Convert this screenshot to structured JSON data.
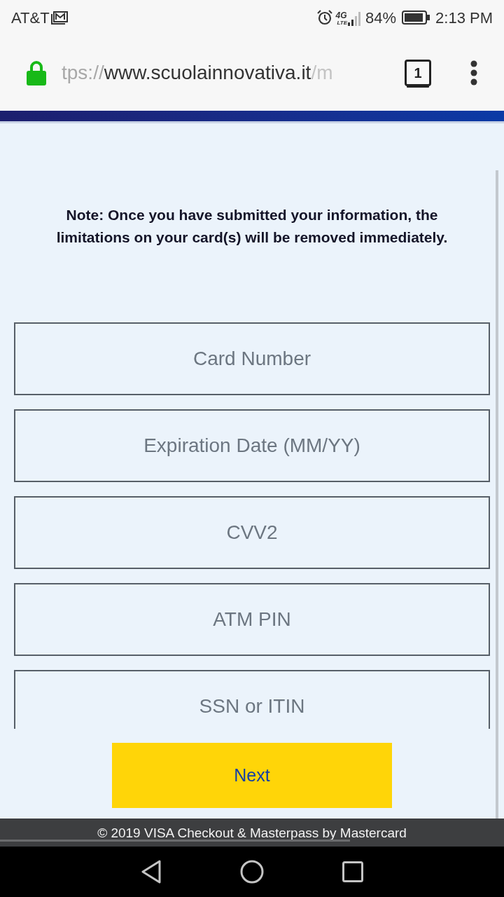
{
  "status_bar": {
    "carrier": "AT&T",
    "network": "4G",
    "network_sub": "LTE",
    "battery": "84%",
    "time": "2:13 PM"
  },
  "browser": {
    "url": {
      "scheme": "tps://",
      "host": "www.scuolainnovativa.it",
      "path": "/m"
    },
    "tab_count": "1"
  },
  "note": "Note: Once you have submitted your information, the limitations on your card(s) will be removed immediately.",
  "fields": [
    {
      "placeholder": "Card Number"
    },
    {
      "placeholder": "Expiration Date (MM/YY)"
    },
    {
      "placeholder": "CVV2"
    },
    {
      "placeholder": "ATM PIN"
    },
    {
      "placeholder": "SSN or ITIN"
    }
  ],
  "next_button": "Next",
  "footer": "© 2019 VISA Checkout & Masterpass by Mastercard"
}
